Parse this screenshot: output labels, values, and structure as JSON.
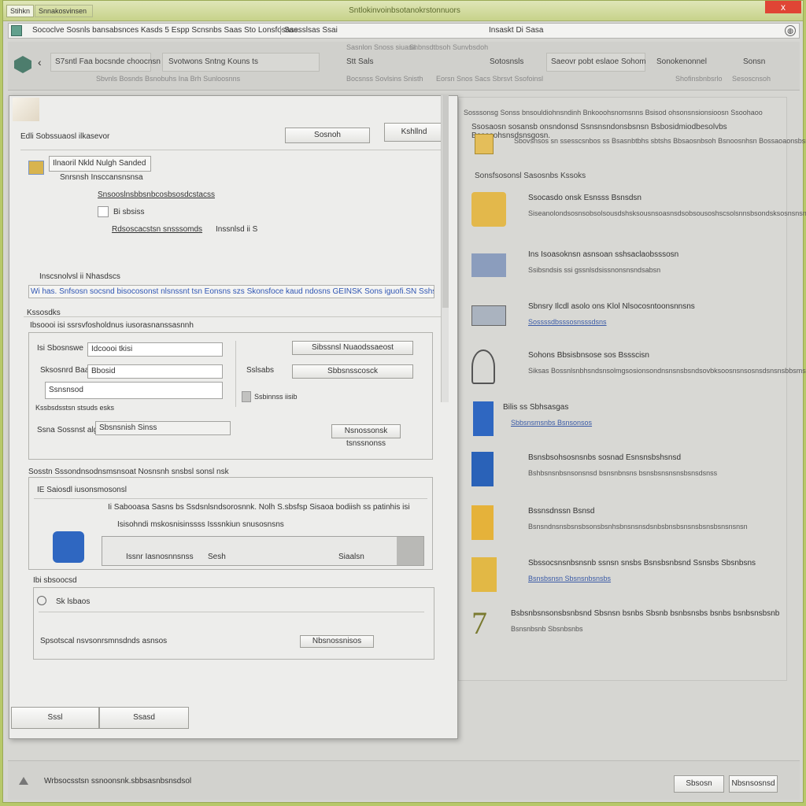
{
  "window": {
    "app_button": "Stihkn",
    "app_menu": "Snnakosvinsen",
    "title": "Sntlokinvoinbsotanokrstonnuors",
    "close": "x"
  },
  "address": {
    "path": "Sococlve  Sosnls bansabsnces  Kasds  5  Espp  Scnsnbs  Saas  Sto   Lonsfosass.",
    "segment": "Saesslsas    Ssai",
    "center": "Insaskt  Di  Sasa"
  },
  "ribbon": {
    "back": "‹",
    "items": [
      {
        "label": "S7sntl  Faa  bocsnde  choocnsn",
        "sub": "Sbvnls  Bosnds  Bsnobuhs  Ina  Brh  Sunloosnns"
      },
      {
        "label": "Svotwons  Sntng  Kouns ts",
        "sub": ""
      },
      {
        "label": "Stt  Sals",
        "sub": "Bocsnss  Sovlsins  Snisth"
      },
      {
        "label": "Sotosnsls",
        "sub": "Eorsn  Snos  Sacs  Sbrsvt  Ssofoinsl"
      },
      {
        "label": "Saeovr  pobt  eslaoe  Sohom",
        "sub": ""
      },
      {
        "label": "Sonokenonnel",
        "sub": "Shofinsbnbsrlo"
      },
      {
        "label": "Sonsn",
        "sub": "Sesoscnsoh"
      }
    ],
    "top_labels": [
      "Sasnlon  Snoss  siuasa",
      "Shbnsdtbsoh  Sunvbsdoh"
    ]
  },
  "dialog": {
    "title": "Edli  Sobssuaosl  ilkasevor",
    "btn_search": "Sosnoh",
    "btn_right": "Kshllnd",
    "item_title": "Ilnaoril  Nkld  Nulgh  Sanded",
    "item_sub": "Snrsnsh  Insccansnsnsa",
    "link_line": "Snsooslnsbbsnbcosbsosdcstacss",
    "checkbox_label": "Bi  sbsiss",
    "field_a": "Rdsoscacstsn  snsssomds",
    "field_a_suffix": "Inssnlsd  ii  S",
    "section_a": "Inscsnolvsl  ii  Nhasdscs",
    "path_line": "Wi  has.  Snfsosn  socsnd  bisocosonst  nlsnssnt  tsn  Eonsns  szs  Skonsfoce  kaud  ndosns  GEINSK  Sons  iguofi.SN    Sshs",
    "section_b": "Kssosdks",
    "group1_title": "Ibsoooi  isi  ssrsvfosholdnus  iusorasnanssasnnh",
    "g1_label1": "Isi  Sbosnswe",
    "g1_value1": "Idcoooi  tkisi",
    "g1_label2": "Sksosnrd  Baaks",
    "g1_value2": "Bbosid",
    "g1_label3": "Ssnsnsod",
    "g1_btn1": "Sibssnsl  Nuaodssaeost",
    "g1_label4": "Sslsabs",
    "g1_btn2": "Sbbsnsscosck",
    "g1_small": "Ssbinnss  iisib",
    "g1_sub": "Kssbsdsstsn  stsuds  esks",
    "g1_row_label": "Ssna  Sossnst  algse",
    "g1_row_value": "Sbsnsnish  Sinss",
    "g1_row_btn": "Nsnossonsk  tsnssnonss",
    "group2_title": "Sosstn  Sssondnsodnsmsnsoat  Nosnsnh  snsbsl  sonsl  nsk",
    "g2_label1": "IE  Saiosdl  iusonsmosonsl",
    "g2_line1": "Ii  Sabooasa  Sasns  bs  Ssdsnlsndsorosnnk.  Nolh  S.sbsfsp  Sisaoa  bodiish  ss  patinhis  isi",
    "g2_line2": "Isisohndi  mskosnisinssss  Isssnkiun  snusosnsns",
    "g2_cell1": "Issnr   Iasnosnnsnss",
    "g2_cell2": "Sesh",
    "g2_cell3": "Siaalsn",
    "section_c": "Ibi  sbsoocsd",
    "g3_label1": "Sk  lsbaos",
    "g3_label2": "Spsotscal  nsvsonrsmnsdnds  asnsos",
    "g3_btn": "Nbsnossnisos",
    "btn_save": "Sssl",
    "btn_cancel": "Ssasd"
  },
  "right_pane": {
    "head1": "Sosssonsg  Sonss  bnsouldiohnsndinh  Bnkooohsnomsnns  Bsisod  ohsonsnsionsioosn  Ssoohaoo",
    "head2": "Ssosaosn  sosansb  onsndonsd  Ssnsnsndonsbsnsn  Bsbosidmiodbesolvbs  Bosasohsnsdsnsgosn.",
    "head3": "Sbovsnsos  sn  ssesscsnbos  ss  Bsasnbtbhs  sbtshs  Bbsaosnbsoh  Bsnoosnhsn  Bossaoaonsbsn",
    "section": "Sonsfsosonsl  Sasosnbs  Kssoks",
    "items": [
      {
        "title": "Ssocasdo  onsk  Esnsss  Bsnsdsn",
        "desc": "Siseanolondsosnsobsolsousdshsksousnsoasnsdsobsousoshscsolsnnsbsondsksosnsnsnshsn",
        "link": false,
        "color": "#d9b54a"
      },
      {
        "title": "Ins  Isoasoknsn  asnsoan  sshsaclaobsssosn",
        "desc": "Ssibsndsis  ssi  gssnlsdsissnonsnsndsabsn",
        "link": false,
        "color": "#8fa3c4"
      },
      {
        "title": "Sbnsry  Ilcdl  asolo  ons  Klol  Nlsocosntoonsnnsns",
        "desc": "Sossssdbsssosnsssdsns",
        "link": true,
        "color": "#9aa6b4"
      },
      {
        "title": "Sohons  Bbsisbnsose  sos  Bssscisn",
        "desc": "Siksas  Bossnlsnbhsndsnsolmgsosionsondnsnsnsbsndsovbksoosnsnsosnsdsnsnsbbsmsnsoh",
        "link": false,
        "color": "#777777"
      },
      {
        "title": "Bilis  ss  Sbhsasgas",
        "desc": "Sbbsnsmsnbs  Bsnsonsos",
        "link": true,
        "color": "#2f67c1"
      },
      {
        "title": "Bsnsbsohsosnsnbs  sosnad  Esnsnsbshsnsd",
        "desc": "Bshbsnsnbsnsonsnsd  bsnsnbnsns  bsnsbsnsnsnsbsnsdsnss",
        "link": false,
        "color": "#2a62b8"
      },
      {
        "title": "Bssnsdnssn  Bsnsd",
        "desc": "Bsnsndnsnsbsnsbsonsbsnhsbnsnsnsdsnbsbnsbsnsnsbsnsbsnsnsnsn",
        "link": false,
        "color": "#e5b23a"
      },
      {
        "title": "Sbssocsnsnbsnsnb  ssnsn  snsbs  Bsnsbsnbsnd  Ssnsbs  Sbsnbsns",
        "desc": "Bsnsbsnsn  Sbsnsnbsnsbs",
        "link": true,
        "color": "#e2b845"
      },
      {
        "title": "Bsbsnbsnsonsbsnbsnd  Sbsnsn  bsnbs  Sbsnb  bsnbsnsbs  bsnbs  bsnbsnsbsnb",
        "desc": "Bsnsnbsnb  Sbsnbsnbs",
        "link": false,
        "color": "#8a8a3a"
      }
    ]
  },
  "footer": {
    "text": "Wrbsocsstsn  ssnoonsnk.sbbsasnbsnsdsol",
    "btn_ok": "Sbsosn",
    "btn_cancel": "Nbsnsosnsd"
  }
}
